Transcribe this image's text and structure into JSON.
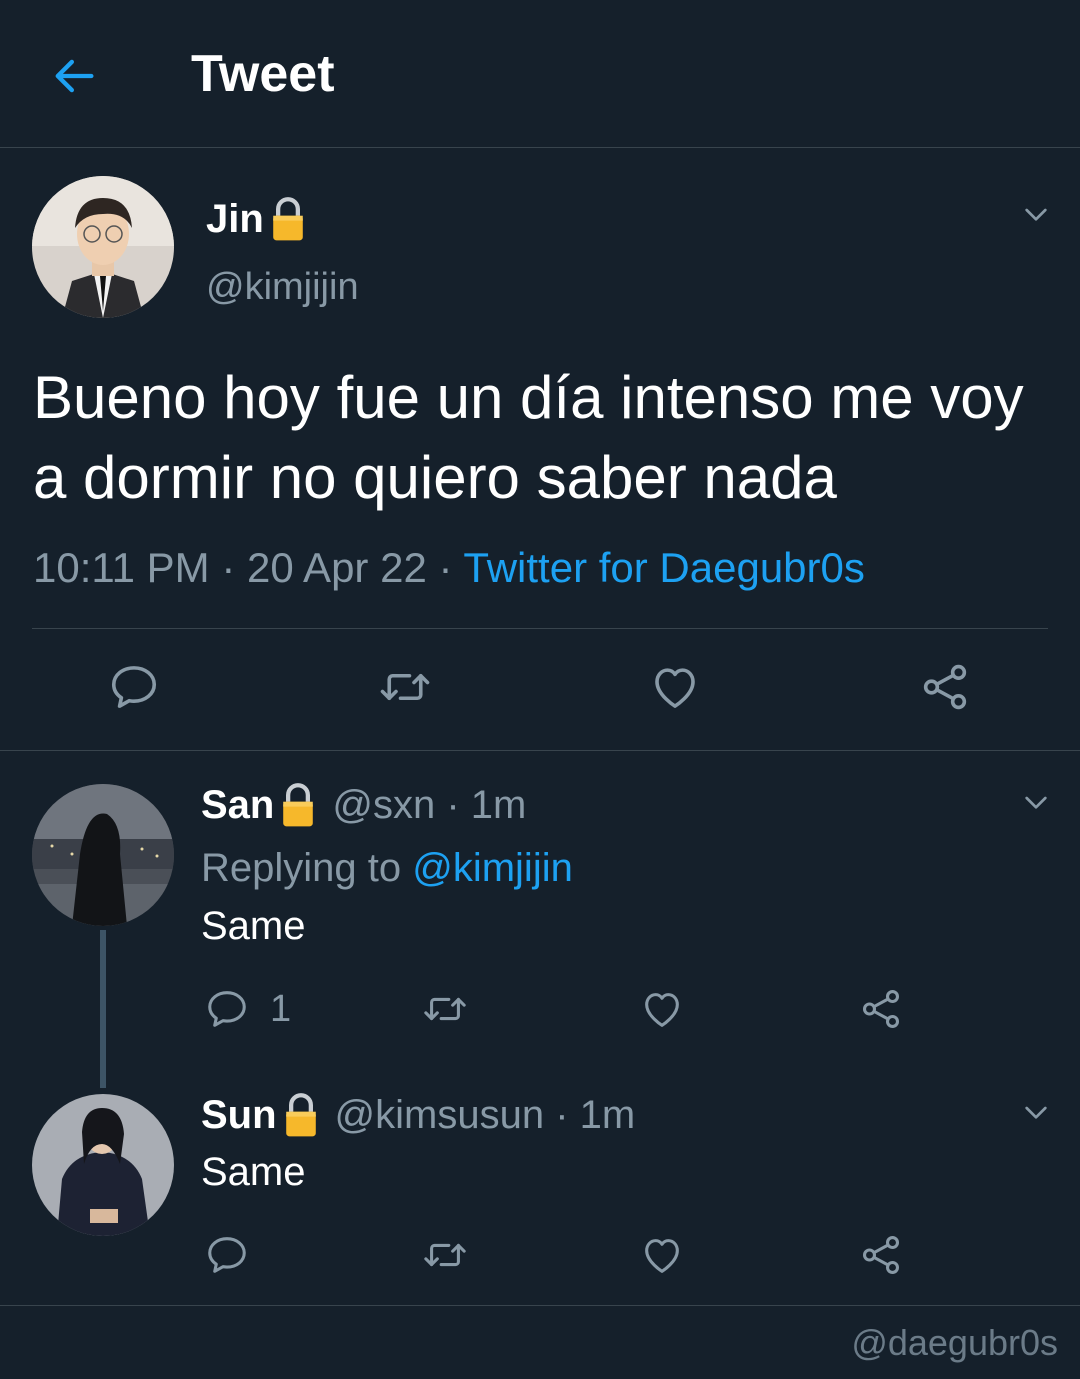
{
  "header": {
    "title": "Tweet"
  },
  "main_tweet": {
    "name": "Jin",
    "handle": "@kimjijin",
    "text": "Bueno hoy fue un día intenso me voy a dormir no quiero saber nada",
    "time": "10:11 PM",
    "sep1": " · ",
    "date": "20 Apr 22",
    "sep2": " · ",
    "client": "Twitter for Daegubr0s"
  },
  "replies": [
    {
      "name": "San",
      "handle": "@sxn · 1m",
      "replying_prefix": "Replying to ",
      "replying_to": "@kimjijin",
      "text": "Same",
      "reply_count": "1"
    },
    {
      "name": "Sun",
      "handle": "@kimsusun · 1m",
      "text": "Same"
    }
  ],
  "watermark": "@daegubr0s",
  "icons": {
    "back": "arrow-left-icon",
    "more": "chevron-down-icon",
    "reply": "speech-bubble-icon",
    "retweet": "retweet-icon",
    "like": "heart-icon",
    "share": "share-icon",
    "lock": "lock-icon"
  },
  "colors": {
    "background": "#15202b",
    "accent": "#1da1f2",
    "secondary_text": "#8899a6",
    "divider": "#38444d"
  }
}
